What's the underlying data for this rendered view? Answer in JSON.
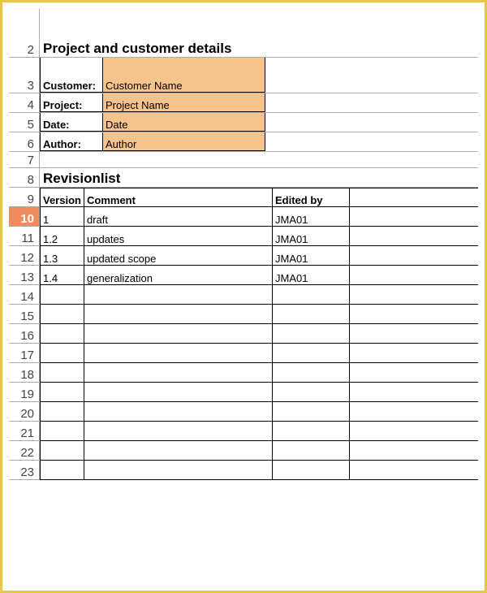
{
  "sections": {
    "project_details_title": "Project and customer details",
    "revisionlist_title": "Revisionlist"
  },
  "details": {
    "rows": [
      {
        "label": "Customer:",
        "value": "Customer Name"
      },
      {
        "label": "Project:",
        "value": "Project Name"
      },
      {
        "label": "Date:",
        "value": "Date"
      },
      {
        "label": "Author:",
        "value": "Author"
      }
    ]
  },
  "revision_table": {
    "headers": {
      "version": "Version",
      "comment": "Comment",
      "edited_by": "Edited by"
    },
    "rows": [
      {
        "version": "1",
        "comment": "draft",
        "edited_by": "JMA01"
      },
      {
        "version": "1.2",
        "comment": "updates",
        "edited_by": "JMA01"
      },
      {
        "version": "1.3",
        "comment": "updated scope",
        "edited_by": "JMA01"
      },
      {
        "version": "1.4",
        "comment": "generalization",
        "edited_by": "JMA01"
      }
    ]
  },
  "row_numbers": [
    "2",
    "3",
    "4",
    "5",
    "6",
    "7",
    "8",
    "9",
    "10",
    "11",
    "12",
    "13",
    "14",
    "15",
    "16",
    "17",
    "18",
    "19",
    "20",
    "21",
    "22",
    "23"
  ],
  "selected_row": "10"
}
